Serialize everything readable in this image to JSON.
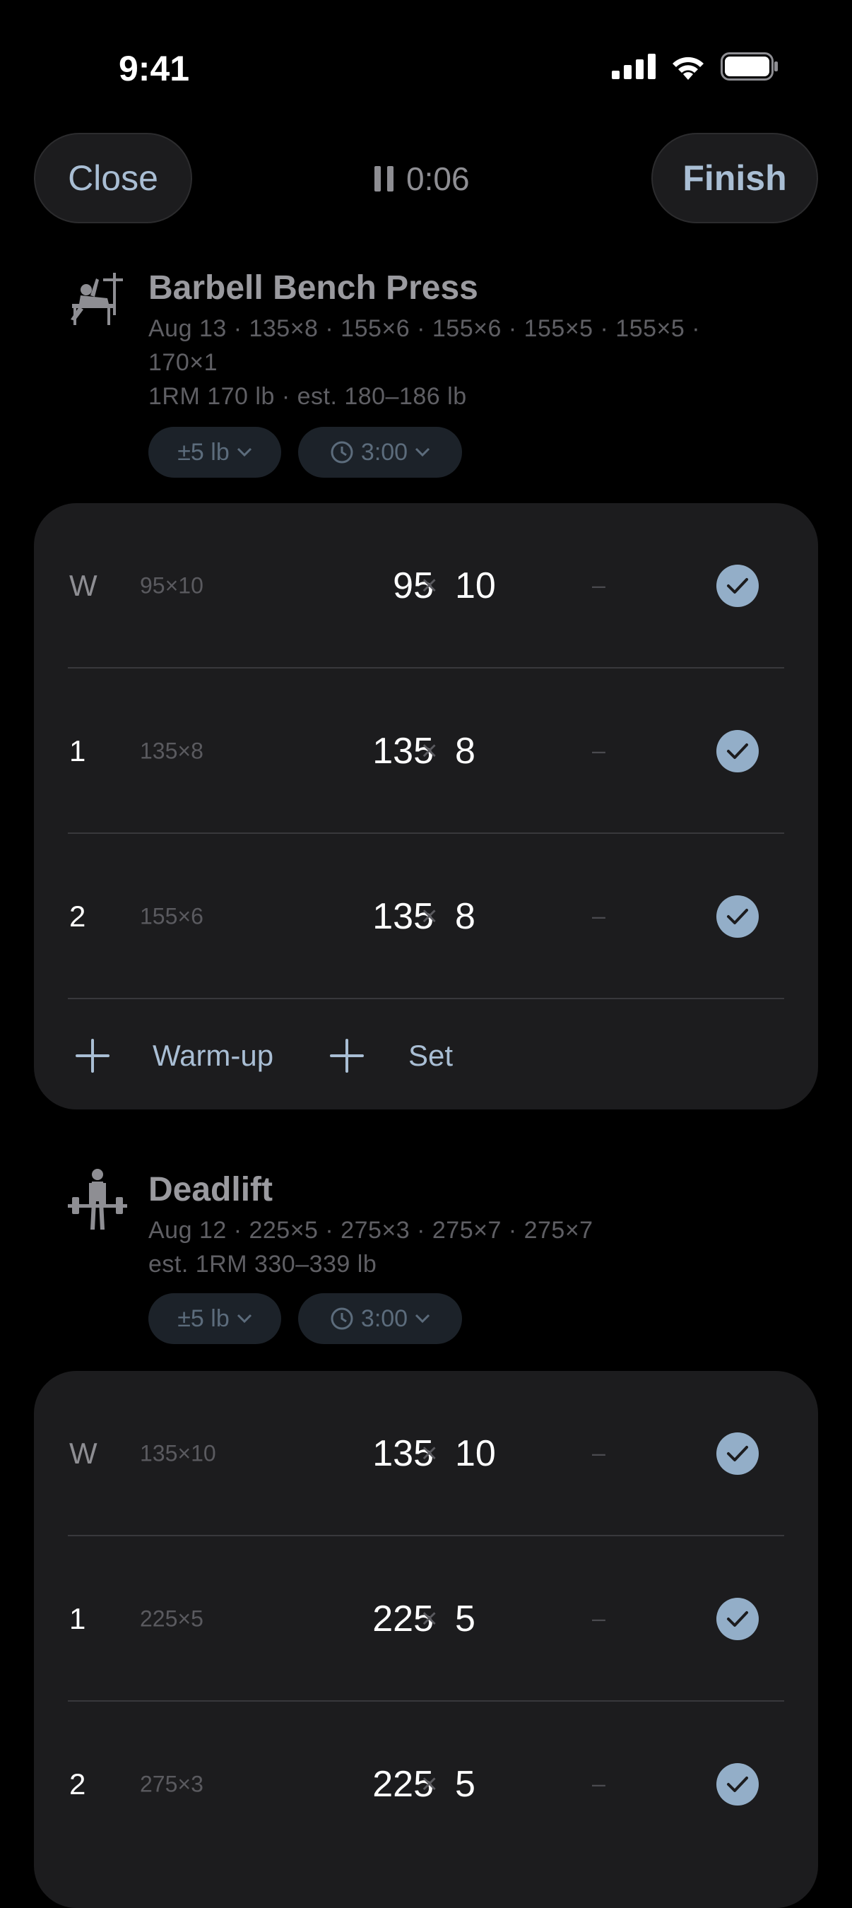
{
  "status": {
    "time": "9:41"
  },
  "toolbar": {
    "close_label": "Close",
    "finish_label": "Finish",
    "timer": "0:06"
  },
  "exercises": [
    {
      "name": "Barbell Bench Press",
      "history_line1": "Aug 13 · 135×8 · 155×6 · 155×6 · 155×5 · 155×5 ·",
      "history_line2": "170×1",
      "stats": "1RM 170 lb · est. 180–186 lb",
      "increment": "±5 lb",
      "rest": "3:00",
      "sets": [
        {
          "label": "W",
          "previous": "95×10",
          "weight": "95",
          "reps": "10",
          "rpe": "–",
          "done": true
        },
        {
          "label": "1",
          "previous": "135×8",
          "weight": "135",
          "reps": "8",
          "rpe": "–",
          "done": true
        },
        {
          "label": "2",
          "previous": "155×6",
          "weight": "135",
          "reps": "8",
          "rpe": "–",
          "done": true
        }
      ],
      "add_warmup_label": "Warm-up",
      "add_set_label": "Set"
    },
    {
      "name": "Deadlift",
      "history_line1": "Aug 12 · 225×5 · 275×3 · 275×7 · 275×7",
      "stats": "est. 1RM 330–339 lb",
      "increment": "±5 lb",
      "rest": "3:00",
      "sets": [
        {
          "label": "W",
          "previous": "135×10",
          "weight": "135",
          "reps": "10",
          "rpe": "–",
          "done": true
        },
        {
          "label": "1",
          "previous": "225×5",
          "weight": "225",
          "reps": "5",
          "rpe": "–",
          "done": true
        },
        {
          "label": "2",
          "previous": "275×3",
          "weight": "225",
          "reps": "5",
          "rpe": "–",
          "done": true
        }
      ]
    }
  ],
  "times_symbol": "×",
  "colors": {
    "accent": "#93aec8",
    "card": "#1c1c1e",
    "background": "#000000"
  }
}
